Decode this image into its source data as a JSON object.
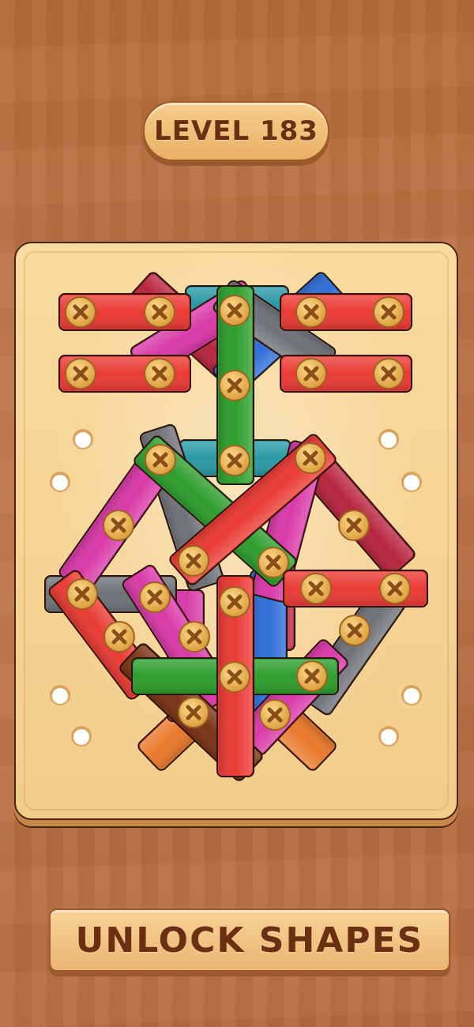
{
  "level": {
    "label": "LEVEL 183"
  },
  "action_button": {
    "label": "UNLOCK SHAPES"
  },
  "colors": {
    "red": "#ea3b34",
    "green": "#2e9e2e",
    "magenta": "#d93aa8",
    "gray": "#6f7278",
    "blue": "#2f6fd6",
    "teal": "#2b9aa6",
    "orange": "#ea7a2c",
    "crimson": "#b8263f",
    "brown": "#7a3515",
    "screw": "#e9b451",
    "hole": "#ffffff"
  },
  "planks": [
    {
      "color": "orange"
    },
    {
      "color": "orange"
    },
    {
      "color": "crimson"
    },
    {
      "color": "blue"
    },
    {
      "color": "teal"
    },
    {
      "color": "magenta"
    },
    {
      "color": "gray"
    },
    {
      "color": "teal"
    },
    {
      "color": "gray"
    },
    {
      "color": "magenta"
    },
    {
      "color": "crimson"
    },
    {
      "color": "gray"
    },
    {
      "color": "crimson"
    },
    {
      "color": "blue"
    },
    {
      "color": "gray"
    },
    {
      "color": "magenta"
    },
    {
      "color": "magenta"
    },
    {
      "color": "magenta"
    },
    {
      "color": "green"
    },
    {
      "color": "red"
    },
    {
      "color": "red"
    },
    {
      "color": "red"
    },
    {
      "color": "brown"
    },
    {
      "color": "green"
    },
    {
      "color": "red"
    },
    {
      "color": "red"
    },
    {
      "color": "red"
    },
    {
      "color": "red"
    },
    {
      "color": "red"
    },
    {
      "color": "green"
    }
  ]
}
